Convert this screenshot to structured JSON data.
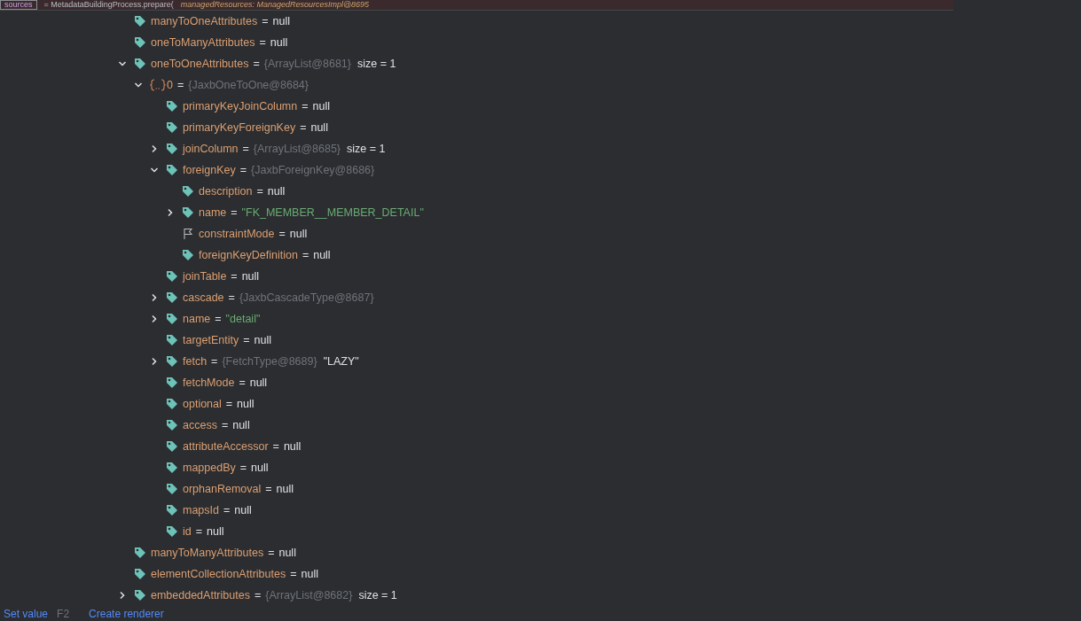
{
  "top_line": {
    "variable": "sources",
    "expression": "= MetadataBuildingProcess.prepare(",
    "parameter": "managedResources: ManagedResourcesImpl@8695"
  },
  "tree": [
    {
      "kind": "tag",
      "name": "manyToOneAttributes",
      "eq": "=",
      "value": "null"
    },
    {
      "kind": "tag",
      "name": "oneToManyAttributes",
      "eq": "=",
      "value": "null"
    },
    {
      "kind": "tag",
      "name": "oneToOneAttributes",
      "eq": "=",
      "ref": "{ArrayList@8681}",
      "value": "size = 1",
      "expanded": true,
      "children": [
        {
          "kind": "object",
          "name": "0",
          "eq": "=",
          "ref": "{JaxbOneToOne@8684}",
          "expanded": true,
          "children": [
            {
              "kind": "tag",
              "name": "primaryKeyJoinColumn",
              "eq": "=",
              "value": "null"
            },
            {
              "kind": "tag",
              "name": "primaryKeyForeignKey",
              "eq": "=",
              "value": "null"
            },
            {
              "kind": "tag",
              "name": "joinColumn",
              "eq": "=",
              "ref": "{ArrayList@8685}",
              "value": "size = 1",
              "expanded": false
            },
            {
              "kind": "tag",
              "name": "foreignKey",
              "eq": "=",
              "ref": "{JaxbForeignKey@8686}",
              "expanded": true,
              "children": [
                {
                  "kind": "tag",
                  "name": "description",
                  "eq": "=",
                  "value": "null"
                },
                {
                  "kind": "tag",
                  "name": "name",
                  "eq": "=",
                  "string": "\"FK_MEMBER__MEMBER_DETAIL\"",
                  "expanded": false
                },
                {
                  "kind": "flag",
                  "name": "constraintMode",
                  "eq": "=",
                  "value": "null"
                },
                {
                  "kind": "tag",
                  "name": "foreignKeyDefinition",
                  "eq": "=",
                  "value": "null"
                }
              ]
            },
            {
              "kind": "tag",
              "name": "joinTable",
              "eq": "=",
              "value": "null"
            },
            {
              "kind": "tag",
              "name": "cascade",
              "eq": "=",
              "ref": "{JaxbCascadeType@8687}",
              "expanded": false
            },
            {
              "kind": "tag",
              "name": "name",
              "eq": "=",
              "string": "\"detail\"",
              "expanded": false
            },
            {
              "kind": "tag",
              "name": "targetEntity",
              "eq": "=",
              "value": "null"
            },
            {
              "kind": "tag",
              "name": "fetch",
              "eq": "=",
              "ref": "{FetchType@8689}",
              "value": "\"LAZY\"",
              "expanded": false
            },
            {
              "kind": "tag",
              "name": "fetchMode",
              "eq": "=",
              "value": "null"
            },
            {
              "kind": "tag",
              "name": "optional",
              "eq": "=",
              "value": "null"
            },
            {
              "kind": "tag",
              "name": "access",
              "eq": "=",
              "value": "null"
            },
            {
              "kind": "tag",
              "name": "attributeAccessor",
              "eq": "=",
              "value": "null"
            },
            {
              "kind": "tag",
              "name": "mappedBy",
              "eq": "=",
              "value": "null"
            },
            {
              "kind": "tag",
              "name": "orphanRemoval",
              "eq": "=",
              "value": "null"
            },
            {
              "kind": "tag",
              "name": "mapsId",
              "eq": "=",
              "value": "null"
            },
            {
              "kind": "tag",
              "name": "id",
              "eq": "=",
              "value": "null"
            }
          ]
        }
      ]
    },
    {
      "kind": "tag",
      "name": "manyToManyAttributes",
      "eq": "=",
      "value": "null"
    },
    {
      "kind": "tag",
      "name": "elementCollectionAttributes",
      "eq": "=",
      "value": "null"
    },
    {
      "kind": "tag",
      "name": "embeddedAttributes",
      "eq": "=",
      "ref": "{ArrayList@8682}",
      "value": "size = 1",
      "expanded": false
    }
  ],
  "footer": {
    "set_value": "Set value",
    "shortcut": "F2",
    "create_renderer": "Create renderer"
  }
}
